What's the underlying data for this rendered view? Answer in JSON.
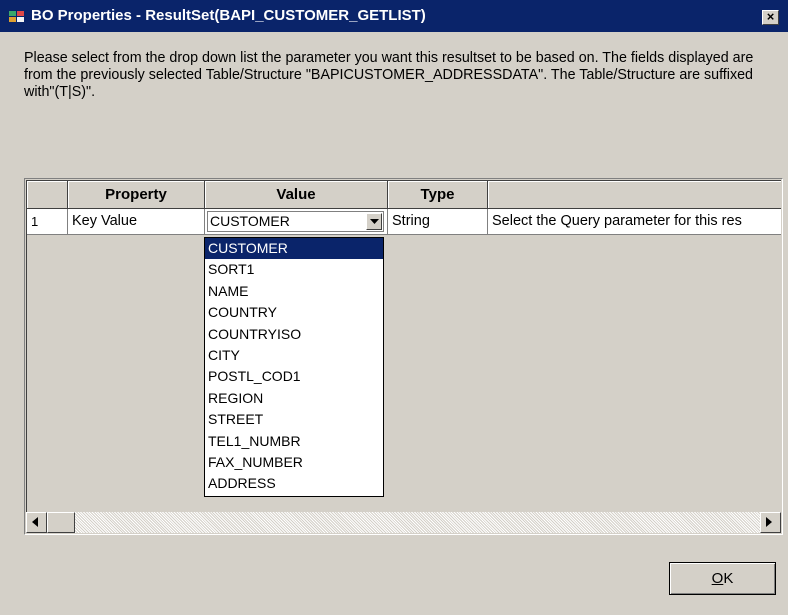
{
  "window": {
    "title": "BO Properties - ResultSet(BAPI_CUSTOMER_GETLIST)",
    "icon": "bo-properties-icon",
    "close_label": "×"
  },
  "description": "Please select from the drop down list the parameter you want this resultset to be based on. The fields displayed are from the previously selected Table/Structure \"BAPICUSTOMER_ADDRESSDATA\". The Table/Structure are suffixed with\"(T|S)\".",
  "grid": {
    "columns": [
      "Property",
      "Value",
      "Type",
      ""
    ],
    "rows": [
      {
        "num": "1",
        "property": "Key Value",
        "value": "CUSTOMER",
        "type": "String",
        "description": "Select the Query parameter for this res"
      }
    ]
  },
  "dropdown": {
    "selected": "CUSTOMER",
    "options": [
      "CUSTOMER",
      "SORT1",
      "NAME",
      "COUNTRY",
      "COUNTRYISO",
      "CITY",
      "POSTL_COD1",
      "REGION",
      "STREET",
      "TEL1_NUMBR",
      "FAX_NUMBER",
      "ADDRESS"
    ]
  },
  "buttons": {
    "ok_mnemonic": "O",
    "ok_rest": "K"
  },
  "colors": {
    "titlebar": "#0a246a",
    "selection": "#0a246a",
    "face": "#d4d0c8"
  }
}
